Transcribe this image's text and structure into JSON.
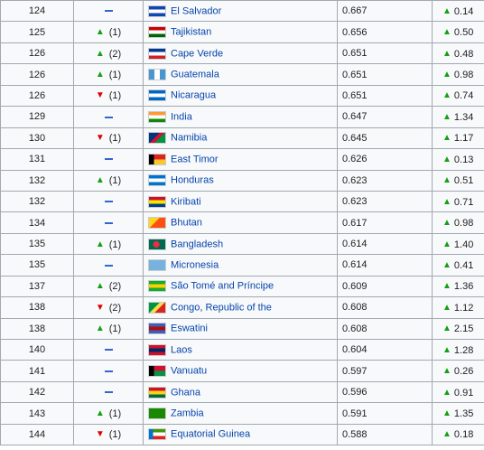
{
  "colors": {
    "link": "#0645ad",
    "up": "#14a014",
    "down": "#dd0000",
    "border": "#a2a9b1",
    "cell_bg": "#f8f9fa",
    "no_change_dash": "#3366cc"
  },
  "rows": [
    {
      "rank": "124",
      "change": {
        "dir": "none",
        "text": ""
      },
      "flag_icon": "el-salvador-flag-icon",
      "flag_colors": [
        "#0f47af",
        "#ffffff",
        "#0f47af"
      ],
      "flag_layout": "h3",
      "country": "El Salvador",
      "hdi": "0.667",
      "delta": "0.14"
    },
    {
      "rank": "125",
      "change": {
        "dir": "up",
        "text": "(1)"
      },
      "flag_icon": "tajikistan-flag-icon",
      "flag_colors": [
        "#cc0000",
        "#ffffff",
        "#006600"
      ],
      "flag_layout": "h3",
      "country": "Tajikistan",
      "hdi": "0.656",
      "delta": "0.50"
    },
    {
      "rank": "126",
      "change": {
        "dir": "up",
        "text": "(2)"
      },
      "flag_icon": "cape-verde-flag-icon",
      "flag_colors": [
        "#003893",
        "#ffffff",
        "#cf2027"
      ],
      "flag_layout": "h3",
      "country": "Cape Verde",
      "hdi": "0.651",
      "delta": "0.48"
    },
    {
      "rank": "126",
      "change": {
        "dir": "up",
        "text": "(1)"
      },
      "flag_icon": "guatemala-flag-icon",
      "flag_colors": [
        "#4997d0",
        "#ffffff",
        "#4997d0"
      ],
      "flag_layout": "v3",
      "country": "Guatemala",
      "hdi": "0.651",
      "delta": "0.98"
    },
    {
      "rank": "126",
      "change": {
        "dir": "down",
        "text": "(1)"
      },
      "flag_icon": "nicaragua-flag-icon",
      "flag_colors": [
        "#0067c6",
        "#ffffff",
        "#0067c6"
      ],
      "flag_layout": "h3",
      "country": "Nicaragua",
      "hdi": "0.651",
      "delta": "0.74"
    },
    {
      "rank": "129",
      "change": {
        "dir": "none",
        "text": ""
      },
      "flag_icon": "india-flag-icon",
      "flag_colors": [
        "#ff9933",
        "#ffffff",
        "#138808"
      ],
      "flag_layout": "h3",
      "country": "India",
      "hdi": "0.647",
      "delta": "1.34"
    },
    {
      "rank": "130",
      "change": {
        "dir": "down",
        "text": "(1)"
      },
      "flag_icon": "namibia-flag-icon",
      "flag_colors": [
        "#003580",
        "#d21034",
        "#009543"
      ],
      "flag_layout": "diag",
      "country": "Namibia",
      "hdi": "0.645",
      "delta": "1.17"
    },
    {
      "rank": "131",
      "change": {
        "dir": "none",
        "text": ""
      },
      "flag_icon": "east-timor-flag-icon",
      "flag_colors": [
        "#dc241f",
        "#000000",
        "#ffc726"
      ],
      "flag_layout": "hoist",
      "country": "East Timor",
      "hdi": "0.626",
      "delta": "0.13"
    },
    {
      "rank": "132",
      "change": {
        "dir": "up",
        "text": "(1)"
      },
      "flag_icon": "honduras-flag-icon",
      "flag_colors": [
        "#0073cf",
        "#ffffff",
        "#0073cf"
      ],
      "flag_layout": "h3",
      "country": "Honduras",
      "hdi": "0.623",
      "delta": "0.51"
    },
    {
      "rank": "132",
      "change": {
        "dir": "none",
        "text": ""
      },
      "flag_icon": "kiribati-flag-icon",
      "flag_colors": [
        "#ce1126",
        "#fce300",
        "#003f87"
      ],
      "flag_layout": "h3",
      "country": "Kiribati",
      "hdi": "0.623",
      "delta": "0.71"
    },
    {
      "rank": "134",
      "change": {
        "dir": "none",
        "text": ""
      },
      "flag_icon": "bhutan-flag-icon",
      "flag_colors": [
        "#ffd520",
        "#ff4e12",
        "#ff4e12"
      ],
      "flag_layout": "diag",
      "country": "Bhutan",
      "hdi": "0.617",
      "delta": "0.98"
    },
    {
      "rank": "135",
      "change": {
        "dir": "up",
        "text": "(1)"
      },
      "flag_icon": "bangladesh-flag-icon",
      "flag_colors": [
        "#006a4e",
        "#f42a41",
        "#006a4e"
      ],
      "flag_layout": "disc",
      "country": "Bangladesh",
      "hdi": "0.614",
      "delta": "1.40"
    },
    {
      "rank": "135",
      "change": {
        "dir": "none",
        "text": ""
      },
      "flag_icon": "micronesia-flag-icon",
      "flag_colors": [
        "#75b2dd",
        "#ffffff",
        "#75b2dd"
      ],
      "flag_layout": "solid",
      "country": "Micronesia",
      "hdi": "0.614",
      "delta": "0.41"
    },
    {
      "rank": "137",
      "change": {
        "dir": "up",
        "text": "(2)"
      },
      "flag_icon": "sao-tome-flag-icon",
      "flag_colors": [
        "#12ad2b",
        "#ffce00",
        "#12ad2b"
      ],
      "flag_layout": "h3",
      "country": "São Tomé and Príncipe",
      "hdi": "0.609",
      "delta": "1.36"
    },
    {
      "rank": "138",
      "change": {
        "dir": "down",
        "text": "(2)"
      },
      "flag_icon": "congo-flag-icon",
      "flag_colors": [
        "#009543",
        "#fbde4a",
        "#dc241f"
      ],
      "flag_layout": "diag",
      "country": "Congo, Republic of the",
      "hdi": "0.608",
      "delta": "1.12"
    },
    {
      "rank": "138",
      "change": {
        "dir": "up",
        "text": "(1)"
      },
      "flag_icon": "eswatini-flag-icon",
      "flag_colors": [
        "#3e5eb9",
        "#b10c0c",
        "#3e5eb9"
      ],
      "flag_layout": "h3",
      "country": "Eswatini",
      "hdi": "0.608",
      "delta": "2.15"
    },
    {
      "rank": "140",
      "change": {
        "dir": "none",
        "text": ""
      },
      "flag_icon": "laos-flag-icon",
      "flag_colors": [
        "#ce1126",
        "#002868",
        "#ce1126"
      ],
      "flag_layout": "h3",
      "country": "Laos",
      "hdi": "0.604",
      "delta": "1.28"
    },
    {
      "rank": "141",
      "change": {
        "dir": "none",
        "text": ""
      },
      "flag_icon": "vanuatu-flag-icon",
      "flag_colors": [
        "#d21034",
        "#000000",
        "#009543"
      ],
      "flag_layout": "hoist",
      "country": "Vanuatu",
      "hdi": "0.597",
      "delta": "0.26"
    },
    {
      "rank": "142",
      "change": {
        "dir": "none",
        "text": ""
      },
      "flag_icon": "ghana-flag-icon",
      "flag_colors": [
        "#ce1126",
        "#fcd116",
        "#006b3f"
      ],
      "flag_layout": "h3",
      "country": "Ghana",
      "hdi": "0.596",
      "delta": "0.91"
    },
    {
      "rank": "143",
      "change": {
        "dir": "up",
        "text": "(1)"
      },
      "flag_icon": "zambia-flag-icon",
      "flag_colors": [
        "#198a00",
        "#198a00",
        "#de2010"
      ],
      "flag_layout": "solid",
      "country": "Zambia",
      "hdi": "0.591",
      "delta": "1.35"
    },
    {
      "rank": "144",
      "change": {
        "dir": "down",
        "text": "(1)"
      },
      "flag_icon": "equatorial-guinea-flag-icon",
      "flag_colors": [
        "#3e9a00",
        "#ffffff",
        "#e32118"
      ],
      "flag_layout": "hoist-blue",
      "country": "Equatorial Guinea",
      "hdi": "0.588",
      "delta": "0.18"
    }
  ]
}
